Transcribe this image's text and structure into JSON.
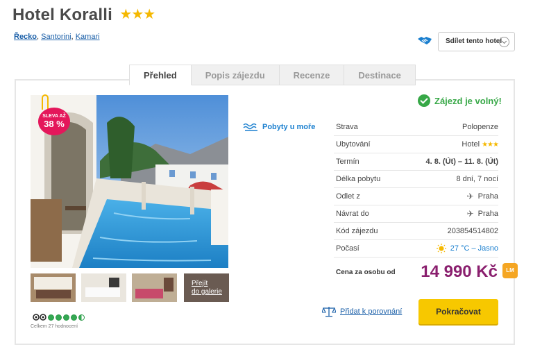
{
  "hotel": {
    "name": "Hotel Koralli",
    "stars": "★★★"
  },
  "breadcrumb": [
    "Řecko",
    "Santorini",
    "Kamari"
  ],
  "share": {
    "label": "Sdílet tento hotel"
  },
  "tabs": [
    {
      "label": "Přehled",
      "active": true
    },
    {
      "label": "Popis zájezdu",
      "active": false
    },
    {
      "label": "Recenze",
      "active": false
    },
    {
      "label": "Destinace",
      "active": false
    }
  ],
  "badge": {
    "line1": "SLEVA AŽ",
    "line2": "38 %"
  },
  "gallery": {
    "link_line1": "Přejít",
    "link_line2": "do galerie"
  },
  "reviews": {
    "count_text": "Celkem 27 hodnocení",
    "rating_dots": 4.5
  },
  "pobyty": {
    "label": "Pobyty u moře"
  },
  "availability": {
    "label": "Zájezd je volný!"
  },
  "details": [
    {
      "key": "Strava",
      "value": "Polopenze"
    },
    {
      "key": "Ubytování",
      "value": "Hotel",
      "stars": "★★★"
    },
    {
      "key": "Termín",
      "value": "4. 8. (Út) – 11. 8. (Út)"
    },
    {
      "key": "Délka pobytu",
      "value": "8 dní, 7 nocí"
    },
    {
      "key": "Odlet z",
      "value": "Praha"
    },
    {
      "key": "Návrat do",
      "value": "Praha"
    },
    {
      "key": "Kód zájezdu",
      "value": "203854514802"
    },
    {
      "key": "Počasí",
      "value": "27 °C – Jasno"
    }
  ],
  "price": {
    "label": "Cena za osobu od",
    "value": "14 990 Kč",
    "tag": "LM"
  },
  "compare": {
    "label": "Přidat k porovnání"
  },
  "cta": {
    "label": "Pokračovat"
  },
  "colors": {
    "accent_blue": "#1a7fcf",
    "price_purple": "#8a1f6e",
    "cta_yellow": "#f7c800",
    "available_green": "#37a847",
    "badge_pink": "#e4175b"
  }
}
